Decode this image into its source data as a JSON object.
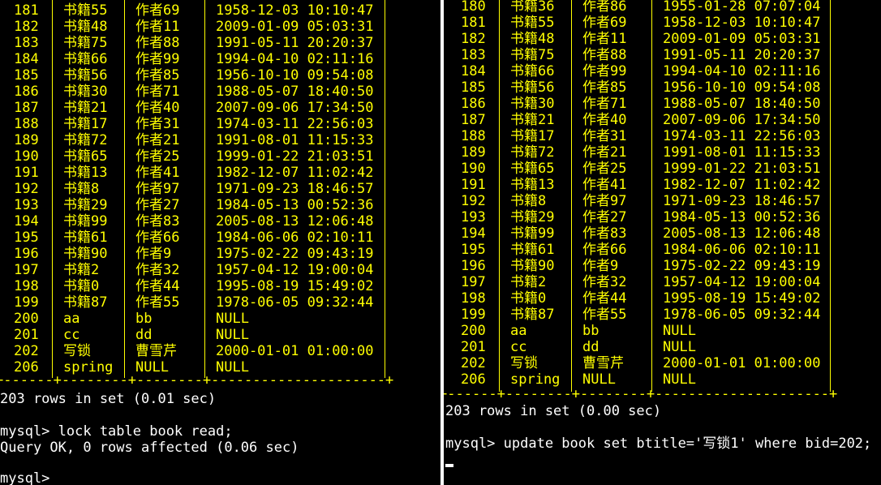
{
  "left": {
    "rows": [
      [
        "181",
        "书籍55",
        "作者69",
        "1958-12-03 10:10:47"
      ],
      [
        "182",
        "书籍48",
        "作者11",
        "2009-01-09 05:03:31"
      ],
      [
        "183",
        "书籍75",
        "作者88",
        "1991-05-11 20:20:37"
      ],
      [
        "184",
        "书籍66",
        "作者99",
        "1994-04-10 02:11:16"
      ],
      [
        "185",
        "书籍56",
        "作者85",
        "1956-10-10 09:54:08"
      ],
      [
        "186",
        "书籍30",
        "作者71",
        "1988-05-07 18:40:50"
      ],
      [
        "187",
        "书籍21",
        "作者40",
        "2007-09-06 17:34:50"
      ],
      [
        "188",
        "书籍17",
        "作者31",
        "1974-03-11 22:56:03"
      ],
      [
        "189",
        "书籍72",
        "作者21",
        "1991-08-01 11:15:33"
      ],
      [
        "190",
        "书籍65",
        "作者25",
        "1999-01-22 21:03:51"
      ],
      [
        "191",
        "书籍13",
        "作者41",
        "1982-12-07 11:02:42"
      ],
      [
        "192",
        "书籍8",
        "作者97",
        "1971-09-23 18:46:57"
      ],
      [
        "193",
        "书籍29",
        "作者27",
        "1984-05-13 00:52:36"
      ],
      [
        "194",
        "书籍99",
        "作者83",
        "2005-08-13 12:06:48"
      ],
      [
        "195",
        "书籍61",
        "作者66",
        "1984-06-06 02:10:11"
      ],
      [
        "196",
        "书籍90",
        "作者9",
        "1975-02-22 09:43:19"
      ],
      [
        "197",
        "书籍2",
        "作者32",
        "1957-04-12 19:00:04"
      ],
      [
        "198",
        "书籍0",
        "作者44",
        "1995-08-19 15:49:02"
      ],
      [
        "199",
        "书籍87",
        "作者55",
        "1978-06-05 09:32:44"
      ],
      [
        "200",
        "aa",
        "bb",
        "NULL"
      ],
      [
        "201",
        "cc",
        "dd",
        "NULL"
      ],
      [
        "202",
        "写锁",
        "曹雪芹",
        "2000-01-01 01:00:00"
      ],
      [
        "206",
        "spring",
        "NULL",
        "NULL"
      ]
    ],
    "border": "+------+--------+--------+---------------------+",
    "status": "203 rows in set (0.01 sec)",
    "command": "mysql> lock table book read;",
    "result": "Query OK, 0 rows affected (0.06 sec)",
    "prompt": "mysql>"
  },
  "right": {
    "rows": [
      [
        "180",
        "书籍36",
        "作者86",
        "1955-01-28 07:07:04"
      ],
      [
        "181",
        "书籍55",
        "作者69",
        "1958-12-03 10:10:47"
      ],
      [
        "182",
        "书籍48",
        "作者11",
        "2009-01-09 05:03:31"
      ],
      [
        "183",
        "书籍75",
        "作者88",
        "1991-05-11 20:20:37"
      ],
      [
        "184",
        "书籍66",
        "作者99",
        "1994-04-10 02:11:16"
      ],
      [
        "185",
        "书籍56",
        "作者85",
        "1956-10-10 09:54:08"
      ],
      [
        "186",
        "书籍30",
        "作者71",
        "1988-05-07 18:40:50"
      ],
      [
        "187",
        "书籍21",
        "作者40",
        "2007-09-06 17:34:50"
      ],
      [
        "188",
        "书籍17",
        "作者31",
        "1974-03-11 22:56:03"
      ],
      [
        "189",
        "书籍72",
        "作者21",
        "1991-08-01 11:15:33"
      ],
      [
        "190",
        "书籍65",
        "作者25",
        "1999-01-22 21:03:51"
      ],
      [
        "191",
        "书籍13",
        "作者41",
        "1982-12-07 11:02:42"
      ],
      [
        "192",
        "书籍8",
        "作者97",
        "1971-09-23 18:46:57"
      ],
      [
        "193",
        "书籍29",
        "作者27",
        "1984-05-13 00:52:36"
      ],
      [
        "194",
        "书籍99",
        "作者83",
        "2005-08-13 12:06:48"
      ],
      [
        "195",
        "书籍61",
        "作者66",
        "1984-06-06 02:10:11"
      ],
      [
        "196",
        "书籍90",
        "作者9",
        "1975-02-22 09:43:19"
      ],
      [
        "197",
        "书籍2",
        "作者32",
        "1957-04-12 19:00:04"
      ],
      [
        "198",
        "书籍0",
        "作者44",
        "1995-08-19 15:49:02"
      ],
      [
        "199",
        "书籍87",
        "作者55",
        "1978-06-05 09:32:44"
      ],
      [
        "200",
        "aa",
        "bb",
        "NULL"
      ],
      [
        "201",
        "cc",
        "dd",
        "NULL"
      ],
      [
        "202",
        "写锁",
        "曹雪芹",
        "2000-01-01 01:00:00"
      ],
      [
        "206",
        "spring",
        "NULL",
        "NULL"
      ]
    ],
    "border": "+------+--------+--------+---------------------+",
    "status": "203 rows in set (0.00 sec)",
    "command": "mysql> update book set btitle='写锁1' where bid=202;"
  }
}
